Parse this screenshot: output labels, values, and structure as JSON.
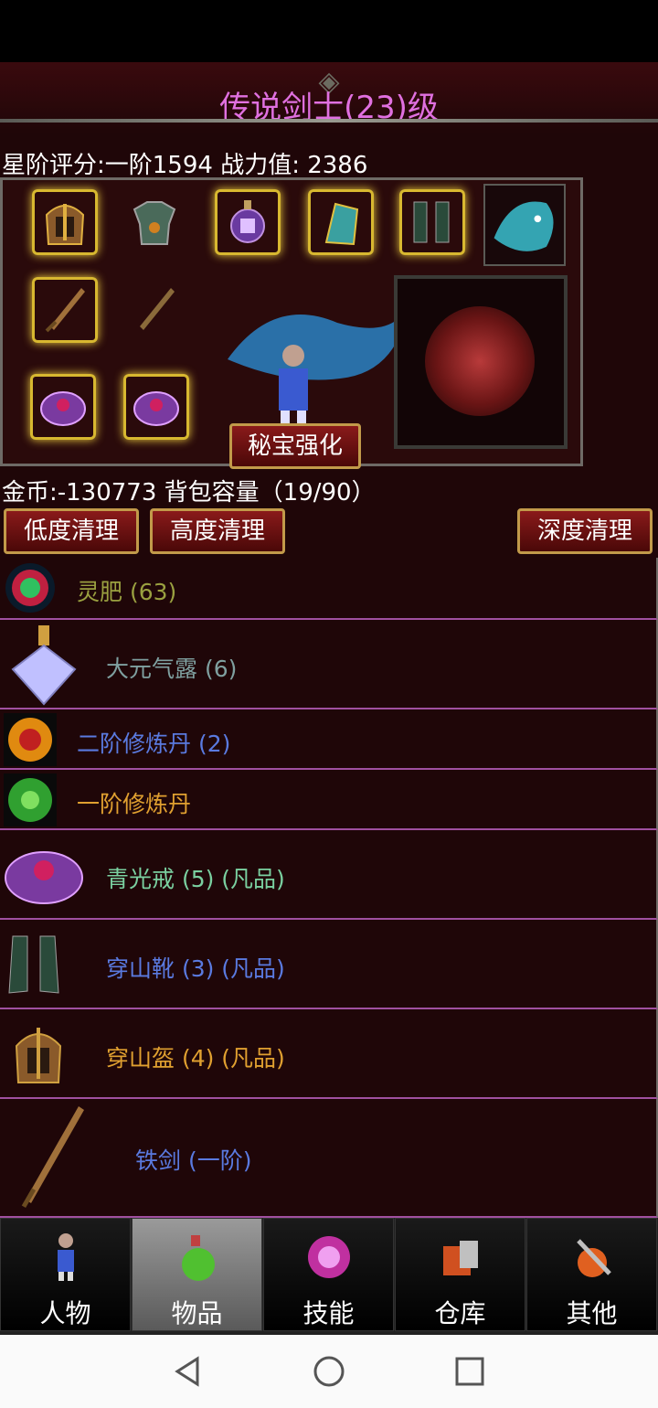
{
  "header": {
    "title": "传说剑士(23)级",
    "score_line": "星阶评分:一阶1594 战力值: 2386"
  },
  "equipment": {
    "secret_button": "秘宝强化"
  },
  "inventory": {
    "gold_line": "金币:-130773 背包容量（19/90）",
    "clean_buttons": [
      "低度清理",
      "高度清理",
      "深度清理"
    ],
    "items": [
      {
        "label": "灵肥 (63)",
        "color": "#9aa040",
        "icon": "green-orb-icon"
      },
      {
        "label": "大元气露 (6)",
        "color": "#7fa0a0",
        "icon": "crystal-flask-icon"
      },
      {
        "label": "二阶修炼丹 (2)",
        "color": "#5a7ae0",
        "icon": "orange-pill-icon"
      },
      {
        "label": "一阶修炼丹",
        "color": "#e0a030",
        "icon": "green-pill-icon"
      },
      {
        "label": "青光戒 (5) (凡品)",
        "color": "#7ad0a0",
        "icon": "ring-icon"
      },
      {
        "label": "穿山靴 (3) (凡品)",
        "color": "#5a7ae0",
        "icon": "boots-icon"
      },
      {
        "label": "穿山盔 (4) (凡品)",
        "color": "#e0a030",
        "icon": "helmet-icon"
      },
      {
        "label": "铁剑 (一阶)",
        "color": "#5a7ae0",
        "icon": "sword-icon"
      }
    ]
  },
  "tabs": [
    {
      "label": "人物",
      "icon": "character-icon"
    },
    {
      "label": "物品",
      "icon": "potion-icon",
      "active": true
    },
    {
      "label": "技能",
      "icon": "skill-orb-icon"
    },
    {
      "label": "仓库",
      "icon": "warehouse-icon"
    },
    {
      "label": "其他",
      "icon": "other-icon"
    }
  ],
  "colors": {
    "title": "#e070e0",
    "button_border": "#c29a4a",
    "divider": "#a050a0"
  }
}
